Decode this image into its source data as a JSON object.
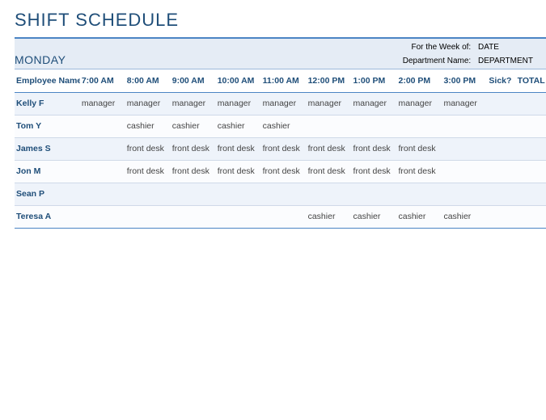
{
  "title": "SHIFT SCHEDULE",
  "day": "MONDAY",
  "meta": {
    "week_label": "For the Week of:",
    "week_value": "DATE",
    "dept_label": "Department Name:",
    "dept_value": "DEPARTMENT"
  },
  "columns": {
    "employee": "Employee Name",
    "times": [
      "7:00 AM",
      "8:00 AM",
      "9:00 AM",
      "10:00 AM",
      "11:00 AM",
      "12:00 PM",
      "1:00 PM",
      "2:00 PM",
      "3:00 PM"
    ],
    "sick": "Sick?",
    "total": "TOTAL"
  },
  "rows": [
    {
      "name": "Kelly F",
      "cells": [
        "manager",
        "manager",
        "manager",
        "manager",
        "manager",
        "manager",
        "manager",
        "manager",
        "manager"
      ]
    },
    {
      "name": "Tom Y",
      "cells": [
        "",
        "cashier",
        "cashier",
        "cashier",
        "cashier",
        "",
        "",
        "",
        ""
      ]
    },
    {
      "name": "James S",
      "cells": [
        "",
        "front desk",
        "front desk",
        "front desk",
        "front desk",
        "front desk",
        "front desk",
        "front desk",
        ""
      ]
    },
    {
      "name": "Jon M",
      "cells": [
        "",
        "front desk",
        "front desk",
        "front desk",
        "front desk",
        "front desk",
        "front desk",
        "front desk",
        ""
      ]
    },
    {
      "name": "Sean P",
      "cells": [
        "",
        "",
        "",
        "",
        "",
        "",
        "",
        "",
        ""
      ]
    },
    {
      "name": "Teresa A",
      "cells": [
        "",
        "",
        "",
        "",
        "",
        "cashier",
        "cashier",
        "cashier",
        "cashier"
      ]
    }
  ]
}
